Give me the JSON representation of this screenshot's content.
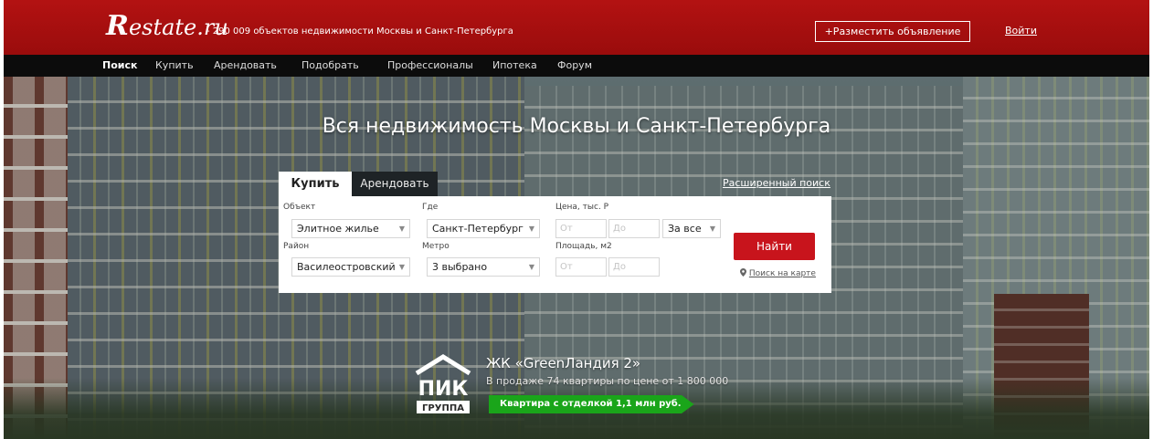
{
  "header": {
    "logo_initial": "R",
    "logo_rest": "estate.ru",
    "tagline": "- 290 009 объектов недвижимости Москвы и Санкт-Петербурга",
    "post_ad": "+Разместить объявление",
    "login": "Войти"
  },
  "nav": {
    "items": [
      {
        "label": "Поиск",
        "active": true
      },
      {
        "label": "Купить"
      },
      {
        "label": "Арендовать"
      },
      {
        "label": "Подобрать"
      },
      {
        "label": "Профессионалы"
      },
      {
        "label": "Ипотека"
      },
      {
        "label": "Форум"
      }
    ]
  },
  "hero": {
    "title": "Вся недвижимость Москвы и Санкт-Петербурга"
  },
  "search": {
    "tabs": [
      {
        "label": "Купить",
        "active": true
      },
      {
        "label": "Арендовать",
        "active": false
      }
    ],
    "advanced_link": "Расширенный поиск",
    "object": {
      "label": "Объект",
      "value": "Элитное жилье"
    },
    "where": {
      "label": "Где",
      "value": "Санкт-Петербург"
    },
    "price": {
      "label": "Цена, тыс. Р",
      "from_placeholder": "От",
      "to_placeholder": "До",
      "unit_value": "За все"
    },
    "district": {
      "label": "Район",
      "value": "Василеостровский"
    },
    "metro": {
      "label": "Метро",
      "value": "3 выбрано"
    },
    "area": {
      "label": "Площадь, м2",
      "from_placeholder": "От",
      "to_placeholder": "До"
    },
    "find_button": "Найти",
    "map_link": "Поиск на карте",
    "dropdown_arrow": "▼"
  },
  "promo": {
    "logo_top": "ПИК",
    "logo_bottom": "ГРУППА",
    "title": "ЖК «GreenЛандия 2»",
    "subtitle": "В продаже 74 квартиры по цене от 1 800 000",
    "badge": "Квартира с отделкой 1,1 млн руб."
  },
  "colors": {
    "brand_red": "#b31212",
    "nav_bg": "#0c0c0c",
    "find_button": "#c8141c",
    "promo_green": "#1aa51a"
  },
  "icons": {
    "map_marker": "map-marker-icon",
    "dropdown": "chevron-down-icon"
  }
}
